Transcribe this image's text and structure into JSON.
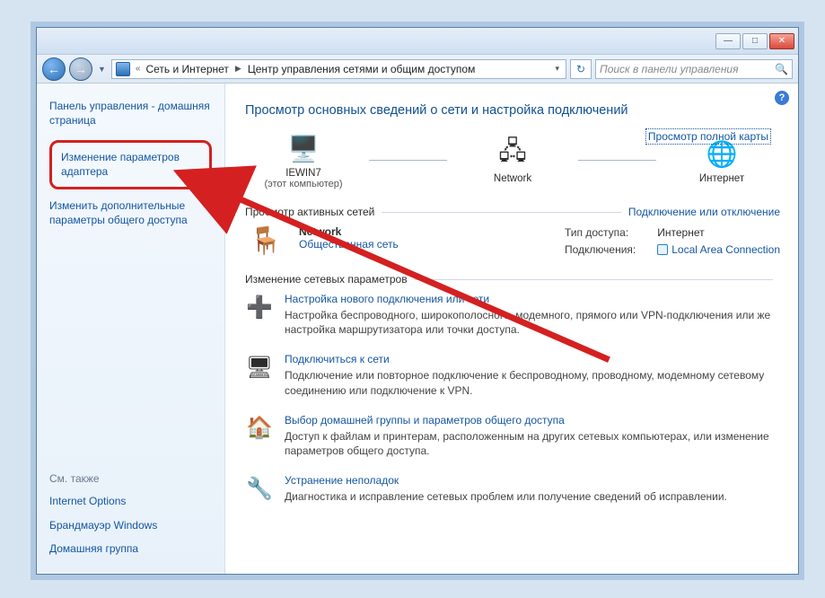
{
  "window_buttons": {
    "minimize": "—",
    "maximize": "□",
    "close": "✕"
  },
  "breadcrumb": {
    "prefix": "«",
    "item1": "Сеть и Интернет",
    "item2": "Центр управления сетями и общим доступом"
  },
  "search": {
    "placeholder": "Поиск в панели управления"
  },
  "sidebar": {
    "home": "Панель управления - домашняя страница",
    "adapter_settings": "Изменение параметров адаптера",
    "advanced_sharing": "Изменить дополнительные параметры общего доступа",
    "see_also": "См. также",
    "links": [
      "Internet Options",
      "Брандмауэр Windows",
      "Домашняя группа"
    ]
  },
  "main": {
    "heading": "Просмотр основных сведений о сети и настройка подключений",
    "map_link": "Просмотр полной карты",
    "diagram": {
      "node1": {
        "label": "IEWIN7",
        "sublabel": "(этот компьютер)"
      },
      "node2": {
        "label": "Network",
        "sublabel": ""
      },
      "node3": {
        "label": "Интернет",
        "sublabel": ""
      }
    },
    "active_header": "Просмотр активных сетей",
    "active_header_link": "Подключение или отключение",
    "active_net": {
      "name": "Network",
      "type": "Общественная сеть",
      "access_label": "Тип доступа:",
      "access_value": "Интернет",
      "conn_label": "Подключения:",
      "conn_value": "Local Area Connection"
    },
    "change_header": "Изменение сетевых параметров",
    "settings": [
      {
        "icon": "➕",
        "title": "Настройка нового подключения или сети",
        "desc": "Настройка беспроводного, широкополосного, модемного, прямого или VPN-подключения или же настройка маршрутизатора или точки доступа."
      },
      {
        "icon": "🖥",
        "title": "Подключиться к сети",
        "desc": "Подключение или повторное подключение к беспроводному, проводному, модемному сетевому соединению или подключение к VPN."
      },
      {
        "icon": "🏠",
        "title": "Выбор домашней группы и параметров общего доступа",
        "desc": "Доступ к файлам и принтерам, расположенным на других сетевых компьютерах, или изменение параметров общего доступа."
      },
      {
        "icon": "🔧",
        "title": "Устранение неполадок",
        "desc": "Диагностика и исправление сетевых проблем или получение сведений об исправлении."
      }
    ]
  }
}
